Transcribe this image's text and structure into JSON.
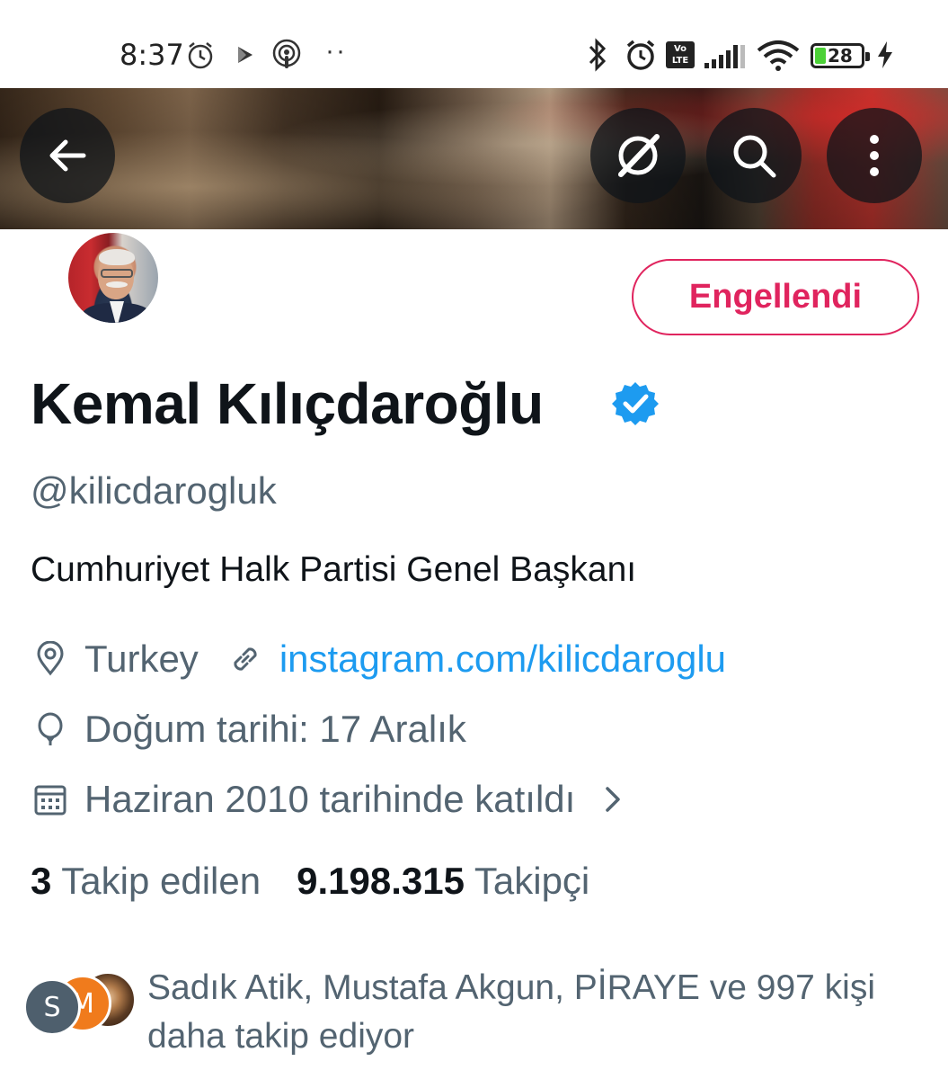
{
  "status_bar": {
    "time": "8:37",
    "dots": "··",
    "volte_top": "Vo",
    "volte_bottom": "LTE",
    "battery": "28"
  },
  "banner": {
    "icons": [
      "back-arrow-icon",
      "grok-icon",
      "search-icon",
      "more-vertical-icon"
    ]
  },
  "profile": {
    "blocked_label": "Engellendi",
    "name": "Kemal Kılıçdaroğlu",
    "handle": "@kilicdarogluk",
    "bio": "Cumhuriyet Halk Partisi Genel Başkanı",
    "location": "Turkey",
    "website": "instagram.com/kilicdaroglu",
    "birthday": "Doğum tarihi: 17 Aralık",
    "joined": "Haziran 2010 tarihinde katıldı"
  },
  "stats": {
    "following_count": "3",
    "following_label": "Takip edilen",
    "followers_count": "9.198.315",
    "followers_label": "Takipçi"
  },
  "followed_by": {
    "avatar1_initial": "S",
    "avatar2_initial": "M",
    "text": "Sadık Atik, Mustafa Akgun, PİRAYE ve 997 kişi daha takip ediyor"
  },
  "colors": {
    "blocked": "#e0245e",
    "link": "#1d9bf0",
    "secondary_text": "#536471",
    "verified": "#1d9bf0"
  }
}
